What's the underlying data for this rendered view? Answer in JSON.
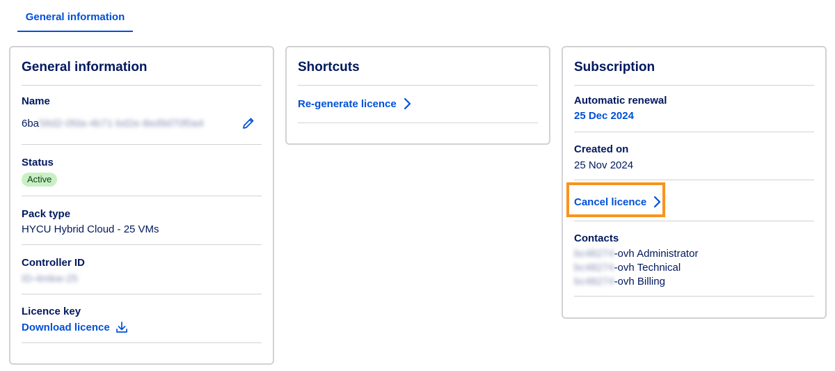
{
  "tabs": {
    "active_label": "General information"
  },
  "general": {
    "title": "General information",
    "name_label": "Name",
    "name_value_visible": "6ba",
    "name_value_hidden": "56d2-0fda-4b71-bd2e-8ed9d70f0a4",
    "status_label": "Status",
    "status_value": "Active",
    "pack_label": "Pack type",
    "pack_value": "HYCU Hybrid Cloud - 25 VMs",
    "controller_label": "Controller ID",
    "controller_value": "ID-4mkw-25",
    "licence_key_label": "Licence key",
    "download_label": "Download licence"
  },
  "shortcuts": {
    "title": "Shortcuts",
    "regenerate_label": "Re-generate licence"
  },
  "subscription": {
    "title": "Subscription",
    "renewal_label": "Automatic renewal",
    "renewal_value": "25 Dec 2024",
    "created_label": "Created on",
    "created_value": "25 Nov 2024",
    "cancel_label": "Cancel licence",
    "contacts_label": "Contacts",
    "contacts": [
      {
        "hidden": "bc48274",
        "suffix": "-ovh Administrator"
      },
      {
        "hidden": "bc48274",
        "suffix": "-ovh Technical"
      },
      {
        "hidden": "bc48274",
        "suffix": "-ovh Billing"
      }
    ]
  },
  "colors": {
    "primary": "#0050d7",
    "text": "#00185e",
    "border": "#d2d2d6",
    "badge_bg": "#c9f0c4",
    "highlight": "#f7941d"
  },
  "icons": {
    "edit": "pencil-icon",
    "download": "download-icon",
    "chevron": "chevron-right-icon"
  }
}
